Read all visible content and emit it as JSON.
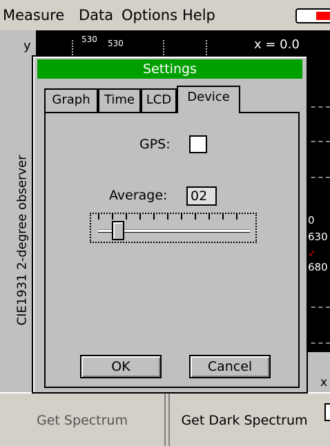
{
  "menu": {
    "items": [
      "Measure",
      "Data",
      "Options",
      "Help"
    ]
  },
  "plot": {
    "y_axis_letter": "y",
    "x_axis_letter": "x",
    "x_readout": "x = 0.0",
    "top_ticks": [
      "530",
      "530"
    ],
    "side_labels": [
      "0",
      "630",
      "680"
    ],
    "vertical_label": "CIE1931 2-degree observer"
  },
  "dialog": {
    "title": "Settings",
    "tabs": [
      "Graph",
      "Time",
      "LCD",
      "Device"
    ],
    "active_tab": "Device",
    "gps_label": "GPS:",
    "gps_checked": false,
    "average_label": "Average:",
    "average_value": "02",
    "slider_level": 0.1,
    "ok_label": "OK",
    "cancel_label": "Cancel"
  },
  "bottom": {
    "spectrum_label": "Get Spectrum",
    "dark_label": "Get Dark Spectrum"
  },
  "colors": {
    "title_bar": "#00a000",
    "battery_level": "#ff0000"
  },
  "icons": [
    "battery-icon",
    "cursor-icon"
  ]
}
